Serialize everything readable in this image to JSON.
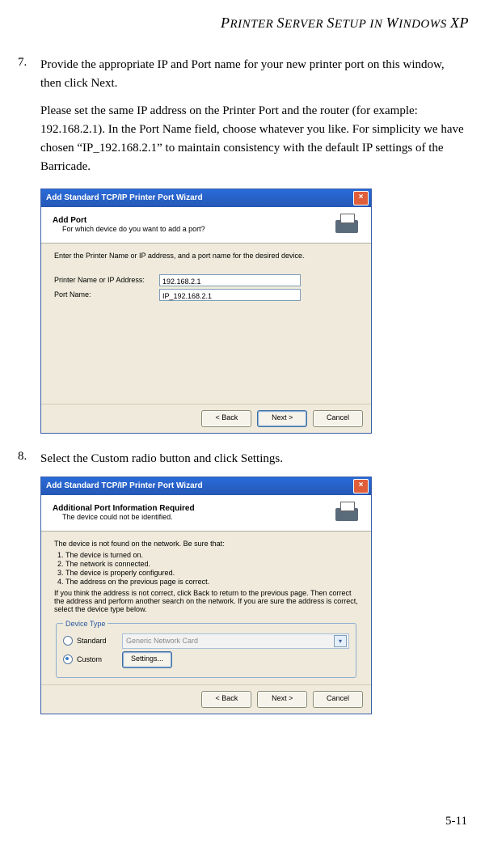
{
  "header_smallcaps": "PRINTER SERVER SETUP IN WINDOWS XP",
  "step7": {
    "num": "7.",
    "text": "Provide the appropriate IP and Port name for your new printer port on this window, then click Next.",
    "para": "Please set the same IP address on the Printer Port and the router (for example: 192.168.2.1). In the Port Name field, choose whatever you like. For simplicity we have chosen “IP_192.168.2.1” to maintain consistency with the default IP settings of the Barricade."
  },
  "step8": {
    "num": "8.",
    "text": "Select the Custom radio button and click Settings."
  },
  "dlg1": {
    "title": "Add Standard TCP/IP Printer Port Wizard",
    "banner_title": "Add Port",
    "banner_sub": "For which device do you want to add a port?",
    "intro": "Enter the Printer Name or IP address, and a port name for the desired device.",
    "label_ip": "Printer Name or IP Address:",
    "label_port": "Port Name:",
    "val_ip": "192.168.2.1",
    "val_port": "IP_192.168.2.1",
    "btn_back": "< Back",
    "btn_next": "Next >",
    "btn_cancel": "Cancel"
  },
  "dlg2": {
    "title": "Add Standard TCP/IP Printer Port Wizard",
    "banner_title": "Additional Port Information Required",
    "banner_sub": "The device could not be identified.",
    "intro": "The device is not found on the network. Be sure that:",
    "checks": [
      "The device is turned on.",
      "The network is connected.",
      "The device is properly configured.",
      "The address on the previous page is correct."
    ],
    "after": "If you think the address is not correct, click Back to return to the previous page. Then correct the address and perform another search on the network. If you are sure the address is correct, select the device type below.",
    "legend": "Device Type",
    "radio_standard": "Standard",
    "radio_custom": "Custom",
    "select_val": "Generic Network Card",
    "btn_settings": "Settings...",
    "btn_back": "< Back",
    "btn_next": "Next >",
    "btn_cancel": "Cancel"
  },
  "page_number": "5-11"
}
